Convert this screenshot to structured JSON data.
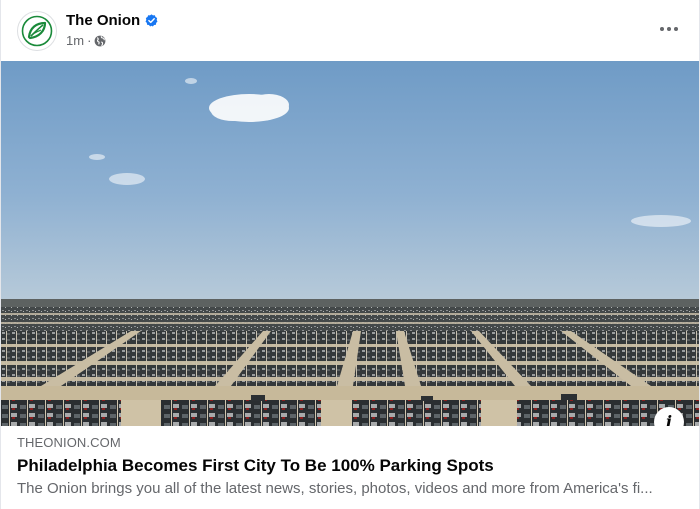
{
  "post": {
    "page_name": "The Onion",
    "verified": true,
    "timestamp": "1m",
    "separator": "·",
    "audience_icon": "globe-icon",
    "more_icon": "more-horizontal-icon"
  },
  "link_preview": {
    "domain": "THEONION.COM",
    "headline": "Philadelphia Becomes First City To Be 100% Parking Spots",
    "description": "The Onion brings you all of the latest news, stories, photos, videos and more from America's fi...",
    "info_icon": "info-icon",
    "info_glyph": "i"
  },
  "colors": {
    "brand_green": "#1a8a3a",
    "verified_blue": "#1877f2",
    "secondary_text": "#65676b",
    "primary_text": "#050505"
  }
}
